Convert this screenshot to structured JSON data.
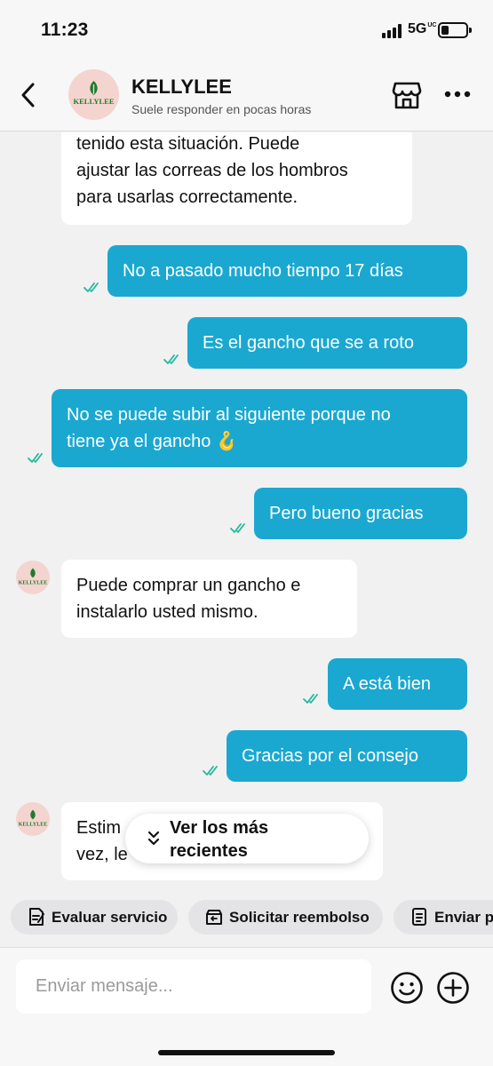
{
  "status_bar": {
    "time": "11:23",
    "network": "5G",
    "network_suffix": "UC"
  },
  "header": {
    "back_icon": "chevron-left-icon",
    "shop_name": "KELLYLEE",
    "avatar_text": "KELLYLEE",
    "response_status": "Suele responder en pocas horas",
    "store_icon": "storefront-icon",
    "more_icon": "more-icon"
  },
  "messages": [
    {
      "direction": "in",
      "lines": [
        "tenido esta situación. Puede",
        "ajustar las correas de los hombros",
        "para usarlas correctamente."
      ]
    },
    {
      "direction": "out",
      "lines": [
        "No a pasado mucho tiempo 17 días"
      ],
      "status": "read"
    },
    {
      "direction": "out",
      "lines": [
        "Es el gancho que se a roto"
      ],
      "status": "read"
    },
    {
      "direction": "out",
      "lines": [
        "No se puede subir al siguiente porque no",
        "tiene ya el gancho 🪝"
      ],
      "status": "read"
    },
    {
      "direction": "out",
      "lines": [
        "Pero bueno gracias"
      ],
      "status": "read"
    },
    {
      "direction": "in",
      "lines": [
        "Puede comprar un gancho e",
        "instalarlo usted mismo."
      ]
    },
    {
      "direction": "out",
      "lines": [
        "A está bien"
      ],
      "status": "read"
    },
    {
      "direction": "out",
      "lines": [
        "Gracias por el consejo"
      ],
      "status": "read"
    },
    {
      "direction": "in",
      "lines": [
        "Estim",
        "vez, le"
      ]
    }
  ],
  "jump_to_latest": {
    "label": "Ver los más recientes",
    "icon": "double-chevron-down-icon"
  },
  "quick_actions": [
    {
      "label": "Evaluar servicio",
      "icon": "review-icon"
    },
    {
      "label": "Solicitar reembolso",
      "icon": "refund-icon"
    },
    {
      "label": "Enviar pe",
      "icon": "order-icon"
    }
  ],
  "composer": {
    "placeholder": "Enviar mensaje...",
    "emoji_icon": "emoji-icon",
    "plus_icon": "plus-icon"
  },
  "colors": {
    "accent": "#1aa8d1",
    "read_tick": "#23b99b",
    "chat_background": "#f1f1f2",
    "avatar_background": "#f4d4cf",
    "logo_green": "#1f7a2e"
  }
}
